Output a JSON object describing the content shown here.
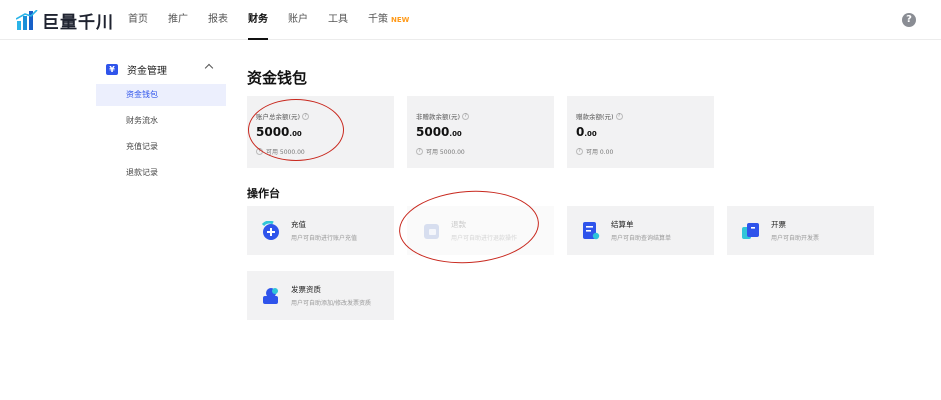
{
  "brand": {
    "name": "巨量千川"
  },
  "nav": {
    "items": [
      {
        "label": "首页",
        "active": false
      },
      {
        "label": "推广",
        "active": false
      },
      {
        "label": "报表",
        "active": false
      },
      {
        "label": "财务",
        "active": true
      },
      {
        "label": "账户",
        "active": false
      },
      {
        "label": "工具",
        "active": false
      },
      {
        "label": "千策",
        "active": false,
        "badge": "NEW"
      }
    ],
    "help": "?"
  },
  "sidebar": {
    "group_icon": "¥",
    "group_label": "资金管理",
    "items": [
      {
        "label": "资金钱包",
        "active": true
      },
      {
        "label": "财务流水",
        "active": false
      },
      {
        "label": "充值记录",
        "active": false
      },
      {
        "label": "退款记录",
        "active": false
      }
    ]
  },
  "wallet": {
    "title": "资金钱包",
    "cards": [
      {
        "label": "账户总余额(元)",
        "amount_int": "5000",
        "amount_dec": ".00",
        "available": "可用 5000.00"
      },
      {
        "label": "非赠款余额(元)",
        "amount_int": "5000",
        "amount_dec": ".00",
        "available": "可用 5000.00"
      },
      {
        "label": "赠款余额(元)",
        "amount_int": "0",
        "amount_dec": ".00",
        "available": "可用 0.00"
      }
    ]
  },
  "console": {
    "title": "操作台",
    "ops": [
      {
        "title": "充值",
        "desc": "用户可自助进行账户充值",
        "icon": "recharge-icon",
        "disabled": false
      },
      {
        "title": "退款",
        "desc": "用户可自助进行退款操作",
        "icon": "refund-icon",
        "disabled": true
      },
      {
        "title": "结算单",
        "desc": "用户可自助查询结算单",
        "icon": "statement-icon",
        "disabled": false
      },
      {
        "title": "开票",
        "desc": "用户可自助开发票",
        "icon": "invoice-icon",
        "disabled": false
      },
      {
        "title": "发票资质",
        "desc": "用户可自助添加/修改发票资质",
        "icon": "invoice-qualification-icon",
        "disabled": false
      }
    ]
  },
  "colors": {
    "accent": "#2f54eb",
    "annotation": "#c8281e",
    "badge": "#ff9a1a"
  }
}
